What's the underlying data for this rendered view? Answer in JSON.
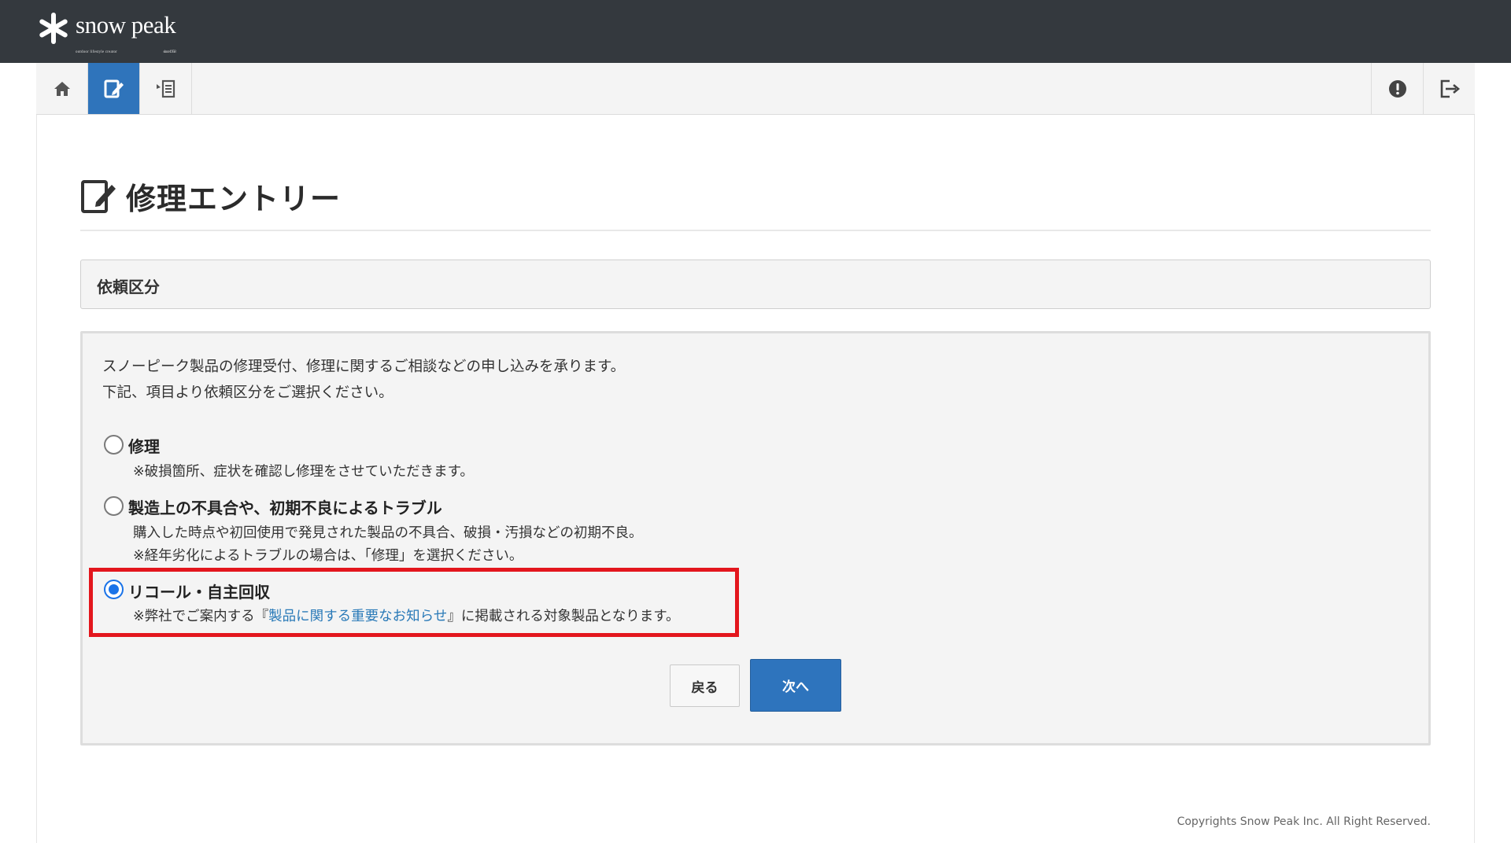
{
  "header": {
    "logo_text": "snow peak",
    "logo_tagline": "outdoor lifestyle creator",
    "logo_since": "since1958"
  },
  "nav": {
    "left_icons": [
      "home-icon",
      "edit-entry-icon",
      "list-entry-icon"
    ],
    "right_icons": [
      "alert-icon",
      "logout-icon"
    ],
    "active_index": 1
  },
  "page": {
    "title": "修理エントリー",
    "section_title": "依頼区分"
  },
  "intro": {
    "line1": "スノーピーク製品の修理受付、修理に関するご相談などの申し込みを承ります。",
    "line2": "下記、項目より依頼区分をご選択ください。"
  },
  "options": [
    {
      "label": "修理",
      "desc1": "※破損箇所、症状を確認し修理をさせていただきます。",
      "checked": false
    },
    {
      "label": "製造上の不具合や、初期不良によるトラブル",
      "desc1": "購入した時点や初回使用で発見された製品の不具合、破損・汚損などの初期不良。",
      "desc2": "※経年劣化によるトラブルの場合は、「修理」を選択ください。",
      "checked": false
    },
    {
      "label": "リコール・自主回収",
      "desc_prefix": "※弊社でご案内する『",
      "desc_link": "製品に関する重要なお知らせ",
      "desc_suffix": "』に掲載される対象製品となります。",
      "checked": true
    }
  ],
  "buttons": {
    "back": "戻る",
    "next": "次へ"
  },
  "footer": {
    "copyright": "Copyrights Snow Peak Inc. All Right Reserved."
  },
  "colors": {
    "topbar": "#34393e",
    "accent": "#2e74bd",
    "highlight": "#e3161d",
    "link": "#2a7ab8"
  }
}
